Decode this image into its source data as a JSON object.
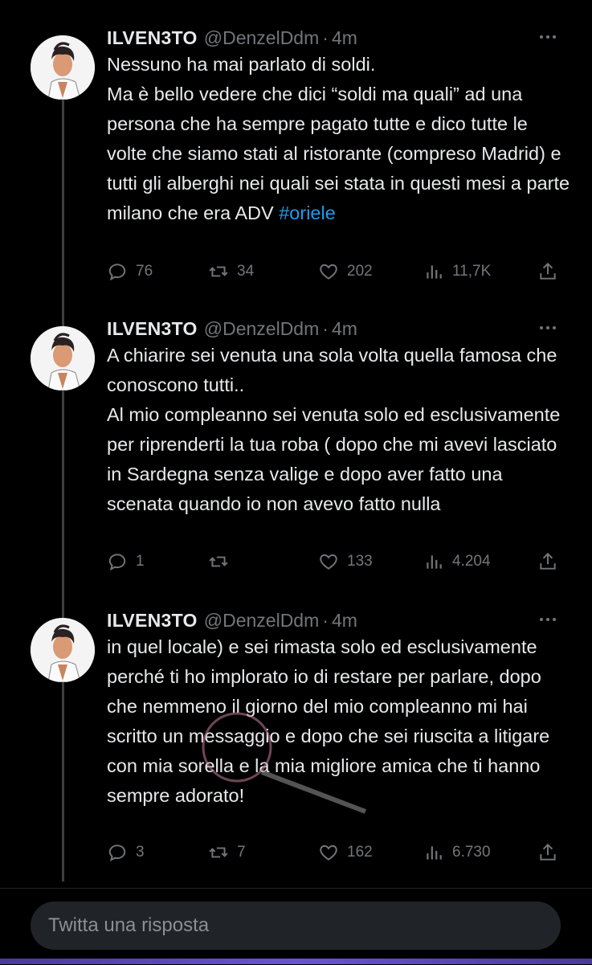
{
  "colors": {
    "background": "#000000",
    "text": "#e7e9ea",
    "muted": "#71767b",
    "link": "#1d9bf0",
    "input_bg": "#202327"
  },
  "tweets": [
    {
      "name": "ILVEN3TO",
      "handle": "@DenzelDdm",
      "separator": "·",
      "time": "4m",
      "text": "Nessuno ha mai parlato di soldi.\nMa è bello vedere che dici “soldi ma quali” ad una persona che ha sempre pagato tutte e dico tutte le volte che siamo stati al ristorante (compreso Madrid) e tutti gli alberghi nei quali sei stata in questi mesi a parte milano che era ADV ",
      "hashtag": "#oriele",
      "replies": "76",
      "retweets": "34",
      "likes": "202",
      "views": "11,7K"
    },
    {
      "name": "ILVEN3TO",
      "handle": "@DenzelDdm",
      "separator": "·",
      "time": "4m",
      "text": "A chiarire sei venuta una sola volta quella famosa che conoscono tutti..\nAl mio compleanno sei venuta solo ed esclusivamente per riprenderti la tua roba ( dopo che mi avevi lasciato in Sardegna senza valige e dopo aver fatto una scenata quando io non avevo fatto nulla",
      "hashtag": "",
      "replies": "1",
      "retweets": "",
      "likes": "133",
      "views": "4.204"
    },
    {
      "name": "ILVEN3TO",
      "handle": "@DenzelDdm",
      "separator": "·",
      "time": "4m",
      "text": "in quel locale) e sei rimasta solo ed esclusivamente perché ti ho implorato io di restare per parlare, dopo che nemmeno il giorno del mio compleanno mi hai scritto un messaggio e dopo che sei riuscita a litigare con mia sorella e la mia migliore amica che ti hanno sempre adorato!",
      "hashtag": "",
      "replies": "3",
      "retweets": "7",
      "likes": "162",
      "views": "6.730"
    }
  ],
  "reply_box": {
    "placeholder": "Twitta una risposta"
  },
  "icons": {
    "reply": "reply-icon",
    "retweet": "retweet-icon",
    "like": "heart-icon",
    "views": "views-icon",
    "share": "share-icon",
    "more": "more-dots-icon"
  }
}
